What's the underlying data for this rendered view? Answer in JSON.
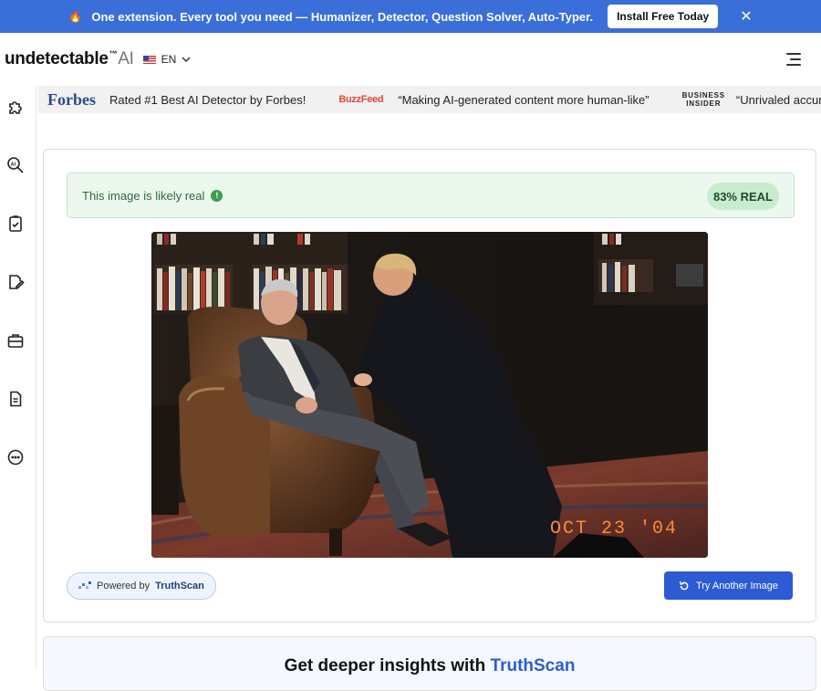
{
  "promo": {
    "fire_icon": "fire-icon",
    "text": "One extension. Every tool you need — Humanizer, Detector, Question Solver, Auto-Typer.",
    "install_label": "Install Free Today",
    "close_glyph": "✕"
  },
  "header": {
    "logo_main": "undetectable",
    "logo_tm": "™",
    "logo_ai": "AI",
    "language": "EN"
  },
  "sidebar": {
    "items": [
      "puzzle-icon",
      "ai-detector-icon",
      "checklist-icon",
      "edit-document-icon",
      "briefcase-icon",
      "document-icon",
      "more-icon"
    ]
  },
  "press": {
    "forbes_logo": "Forbes",
    "forbes_quote": "Rated #1 Best AI Detector by Forbes!",
    "buzzfeed_logo": "BuzzFeed",
    "buzzfeed_quote": "“Making AI-generated content more human-like”",
    "bi_logo_line1": "BUSINESS",
    "bi_logo_line2": "INSIDER",
    "bi_quote": "“Unrivaled accurac"
  },
  "result": {
    "message": "This image is likely real",
    "info_glyph": "!",
    "score": "83% REAL",
    "status_color": "#3aa04e"
  },
  "photo": {
    "date_stamp": "OCT 23 '04"
  },
  "footer_actions": {
    "powered_prefix": "Powered by",
    "powered_brand": "TruthScan",
    "try_label": "Try Another Image"
  },
  "bottom": {
    "heading_prefix": "Get deeper insights with",
    "heading_brand": "TruthScan"
  },
  "colors": {
    "banner": "#3a6ed8",
    "accent": "#2d5bd4",
    "success_bg": "#ecf8ee"
  }
}
